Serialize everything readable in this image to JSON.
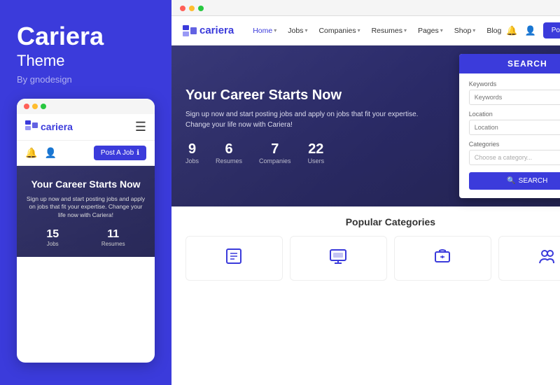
{
  "left": {
    "brand": {
      "title": "Cariera",
      "subtitle": "Theme",
      "by": "By gnodesign"
    },
    "mobile": {
      "logo": "cariera",
      "post_btn": "Post A Job",
      "hero": {
        "title": "Your Career Starts Now",
        "desc": "Sign up now and start posting jobs and apply on jobs that fit your expertise. Change your life now with Cariera!",
        "stats": [
          {
            "num": "15",
            "label": "Jobs"
          },
          {
            "num": "11",
            "label": "Resumes"
          }
        ]
      }
    }
  },
  "right": {
    "nav": {
      "logo": "cariera",
      "links": [
        {
          "label": "Home",
          "hasArrow": true,
          "active": true
        },
        {
          "label": "Jobs",
          "hasArrow": true
        },
        {
          "label": "Companies",
          "hasArrow": true
        },
        {
          "label": "Resumes",
          "hasArrow": true
        },
        {
          "label": "Pages",
          "hasArrow": true
        },
        {
          "label": "Shop",
          "hasArrow": true
        },
        {
          "label": "Blog",
          "hasArrow": false
        }
      ],
      "post_btn": "Post A Job"
    },
    "hero": {
      "title": "Your Career Starts Now",
      "desc_line1": "Sign up now and start posting jobs and apply on jobs that fit your expertise.",
      "desc_line2": "Change your life now with Cariera!",
      "stats": [
        {
          "num": "9",
          "label": "Jobs"
        },
        {
          "num": "6",
          "label": "Resumes"
        },
        {
          "num": "7",
          "label": "Companies"
        },
        {
          "num": "22",
          "label": "Users"
        }
      ]
    },
    "search": {
      "header": "SEARCH",
      "keywords_label": "Keywords",
      "keywords_placeholder": "Keywords",
      "location_label": "Location",
      "location_placeholder": "Location",
      "categories_label": "Categories",
      "categories_placeholder": "Choose a category...",
      "btn": "SEARCH"
    },
    "popular": {
      "title": "Popular Categories",
      "categories": [
        {
          "icon": "✏️"
        },
        {
          "icon": "💻"
        },
        {
          "icon": "🏢"
        },
        {
          "icon": "👥"
        }
      ]
    }
  },
  "colors": {
    "primary": "#3b3bdb",
    "dot_red": "#ff5f57",
    "dot_yellow": "#ffbd2e",
    "dot_green": "#28c840"
  }
}
